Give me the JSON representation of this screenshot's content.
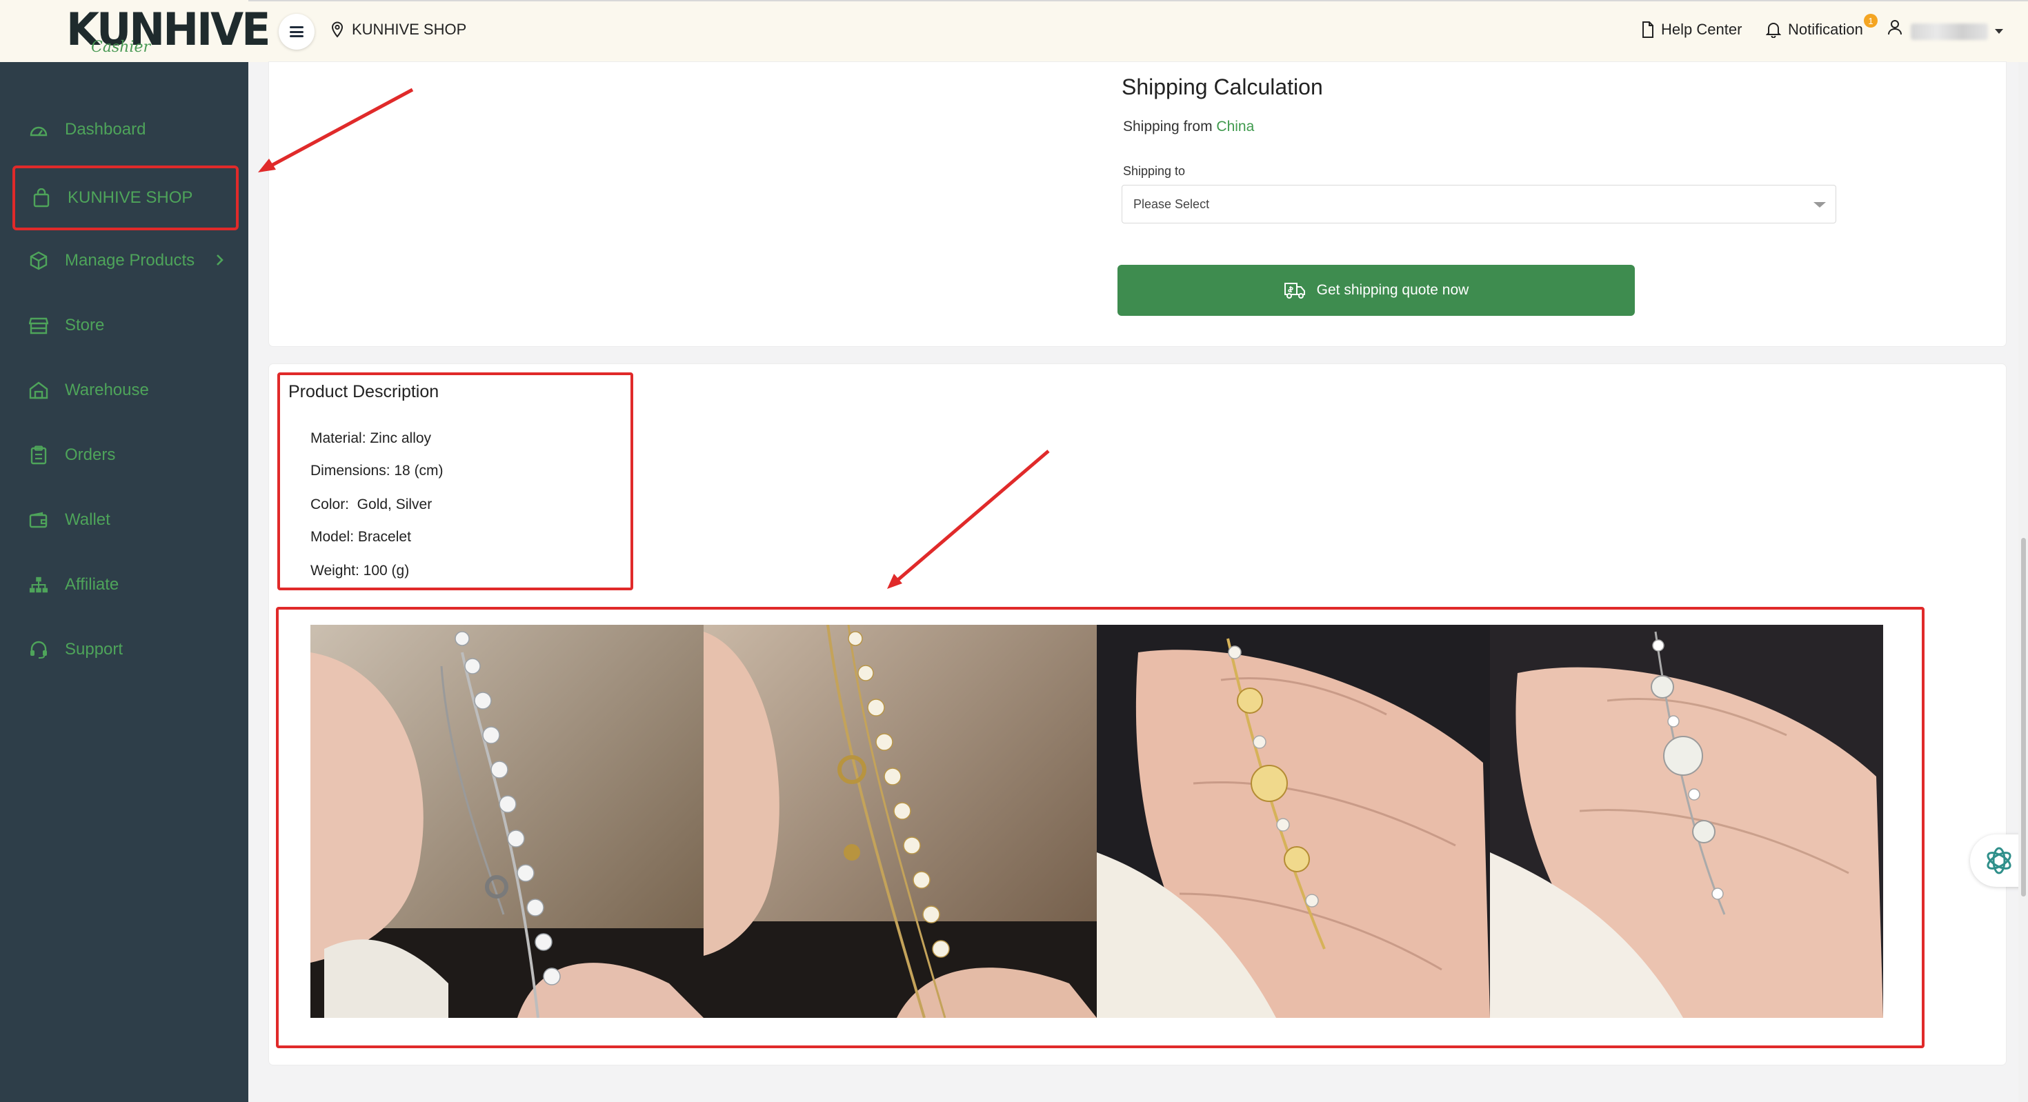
{
  "brand": {
    "logo_text": "KUNHIVE",
    "logo_subtext": "Cashier"
  },
  "header": {
    "breadcrumb": "KUNHIVE SHOP",
    "help_center": "Help Center",
    "notification": "Notification",
    "notification_count": "1"
  },
  "sidebar": {
    "items": [
      {
        "label": "Dashboard",
        "icon": "dashboard-icon"
      },
      {
        "label": "KUNHIVE SHOP",
        "icon": "shopping-bag-icon",
        "active": true
      },
      {
        "label": "Manage Products",
        "icon": "box-icon",
        "has_submenu": true
      },
      {
        "label": "Store",
        "icon": "store-icon"
      },
      {
        "label": "Warehouse",
        "icon": "warehouse-icon"
      },
      {
        "label": "Orders",
        "icon": "clipboard-icon"
      },
      {
        "label": "Wallet",
        "icon": "wallet-icon"
      },
      {
        "label": "Affiliate",
        "icon": "sitemap-icon"
      },
      {
        "label": "Support",
        "icon": "headset-icon"
      }
    ]
  },
  "shipping": {
    "title": "Shipping Calculation",
    "from_prefix": "Shipping from",
    "from_country": "China",
    "to_label": "Shipping to",
    "to_placeholder": "Please Select",
    "quote_button": "Get shipping quote now"
  },
  "description": {
    "title": "Product Description",
    "lines": [
      "Material: Zinc alloy",
      "Dimensions: 18 (cm)",
      "Color:  Gold, Silver",
      "Model: Bracelet",
      "Weight: 100 (g)"
    ]
  },
  "images": [
    {
      "name": "silver-bracelet-in-fingers"
    },
    {
      "name": "gold-bracelet-in-fingers"
    },
    {
      "name": "gold-bracelet-on-hand"
    },
    {
      "name": "silver-bracelet-on-hand"
    }
  ],
  "colors": {
    "accent_green": "#3e8c4f",
    "sidebar_bg": "#2e3e49",
    "highlight_red": "#e02a2a",
    "badge_orange": "#f4a522"
  }
}
